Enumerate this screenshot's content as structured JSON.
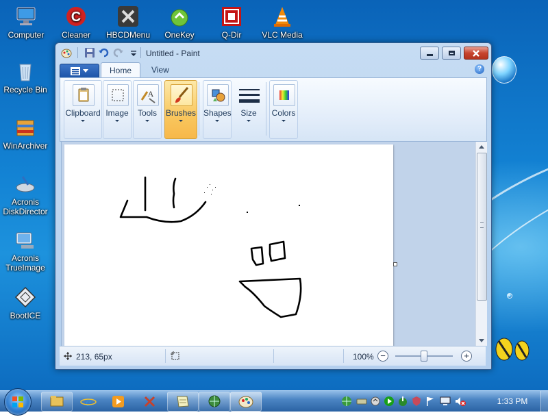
{
  "desktop": {
    "icons": [
      {
        "label": "Computer"
      },
      {
        "label": "Cleaner"
      },
      {
        "label": "HBCDMenu"
      },
      {
        "label": "OneKey"
      },
      {
        "label": "Q-Dir"
      },
      {
        "label": "VLC Media"
      },
      {
        "label": "Recycle Bin"
      },
      {
        "label": "WinArchiver"
      },
      {
        "label": "Acronis DiskDirector",
        "line1": "Acronis",
        "line2": "DiskDirector"
      },
      {
        "label": "Acronis TrueImage",
        "line1": "Acronis",
        "line2": "TrueImage"
      },
      {
        "label": "BootICE"
      }
    ]
  },
  "window": {
    "title": "Untitled - Paint",
    "tabs": [
      {
        "label": "Home",
        "active": true
      },
      {
        "label": "View",
        "active": false
      }
    ],
    "ribbon_groups": [
      {
        "label": "Clipboard",
        "icon": "clipboard-icon"
      },
      {
        "label": "Image",
        "icon": "select-icon"
      },
      {
        "label": "Tools",
        "icon": "tools-icon"
      },
      {
        "label": "Brushes",
        "icon": "brush-icon",
        "active": true
      },
      {
        "label": "Shapes",
        "icon": "shapes-icon"
      },
      {
        "label": "Size",
        "icon": "size-icon"
      },
      {
        "label": "Colors",
        "icon": "palette-icon"
      }
    ],
    "status": {
      "cursor_position": "213, 65px",
      "zoom_level": "100%",
      "zoom_fraction": 0.5
    },
    "accent_color": "#f9c75f"
  },
  "taskbar": {
    "clock": "1:33 PM"
  }
}
